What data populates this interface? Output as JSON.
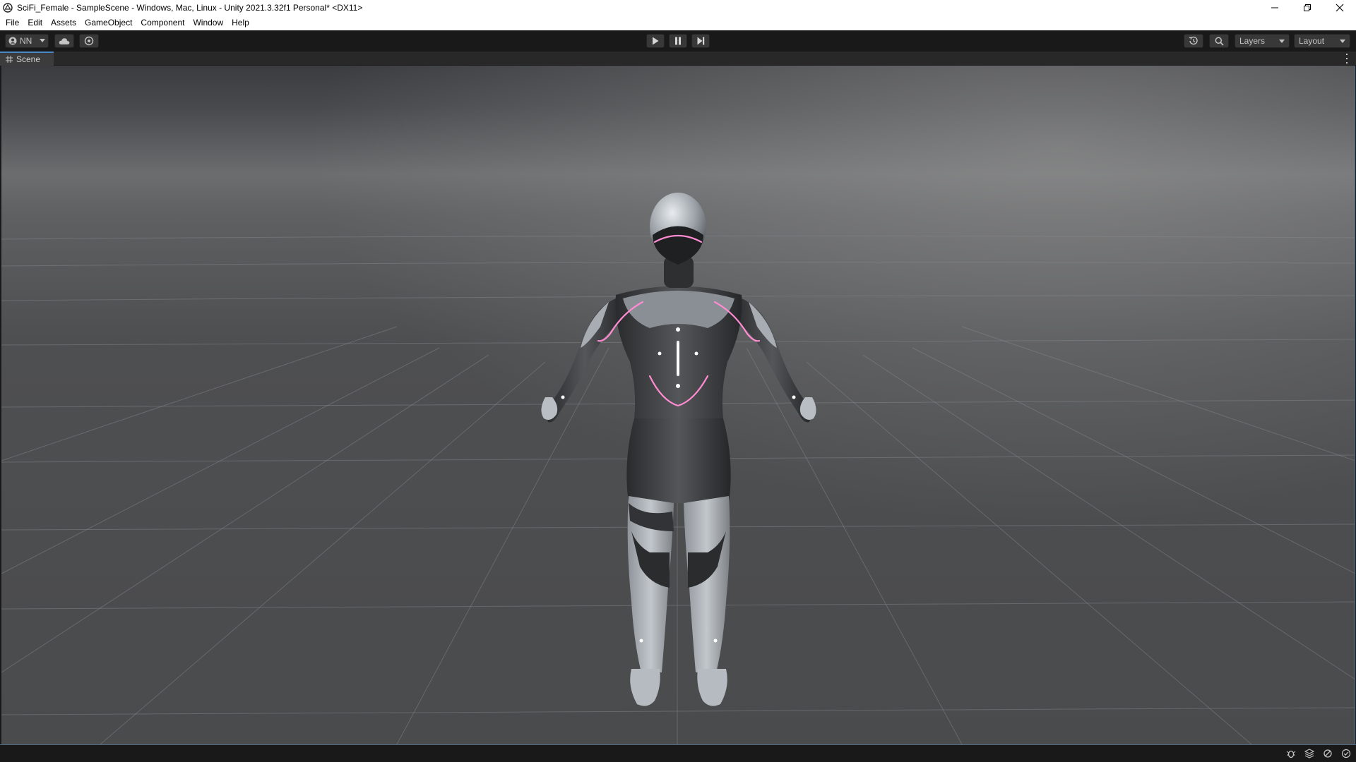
{
  "window": {
    "title": "SciFi_Female - SampleScene - Windows, Mac, Linux - Unity 2021.3.32f1 Personal* <DX11>",
    "controls": [
      "minimize",
      "restore",
      "close"
    ]
  },
  "menu": {
    "items": [
      "File",
      "Edit",
      "Assets",
      "GameObject",
      "Component",
      "Window",
      "Help"
    ]
  },
  "toolbar": {
    "account_label": "NN",
    "layers_label": "Layers",
    "layout_label": "Layout",
    "icons": [
      "account-icon",
      "cloud-icon",
      "collab-icon",
      "play-icon",
      "pause-icon",
      "step-icon",
      "history-icon",
      "search-icon"
    ]
  },
  "scene": {
    "tab_label": "Scene"
  },
  "status": {
    "icons": [
      "bug-icon",
      "layers-stack-icon",
      "auto-refresh-icon",
      "check-icon"
    ]
  },
  "colors": {
    "editor_bg": "#191919",
    "tab_accent": "#4a87c6",
    "glow": "#ff8cd2"
  }
}
